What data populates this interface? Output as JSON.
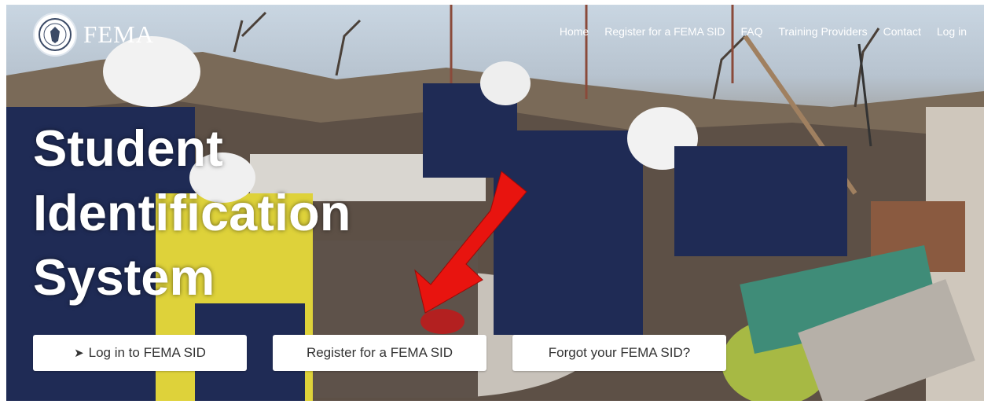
{
  "brand": {
    "name": "FEMA",
    "seal_icon": "dhs-seal-icon"
  },
  "nav": {
    "home": "Home",
    "register": "Register for a FEMA SID",
    "faq": "FAQ",
    "training": "Training Providers",
    "contact": "Contact",
    "login": "Log in"
  },
  "hero": {
    "title_line1": "Student",
    "title_line2": "Identification",
    "title_line3": "System",
    "image_description_icon": "disaster-rescue-photo",
    "arrow_color": "#e8140f"
  },
  "actions": {
    "login_icon": "sign-in-icon",
    "login_label": "Log in to FEMA SID",
    "register_label": "Register for a FEMA SID",
    "forgot_label": "Forgot your FEMA SID?"
  }
}
